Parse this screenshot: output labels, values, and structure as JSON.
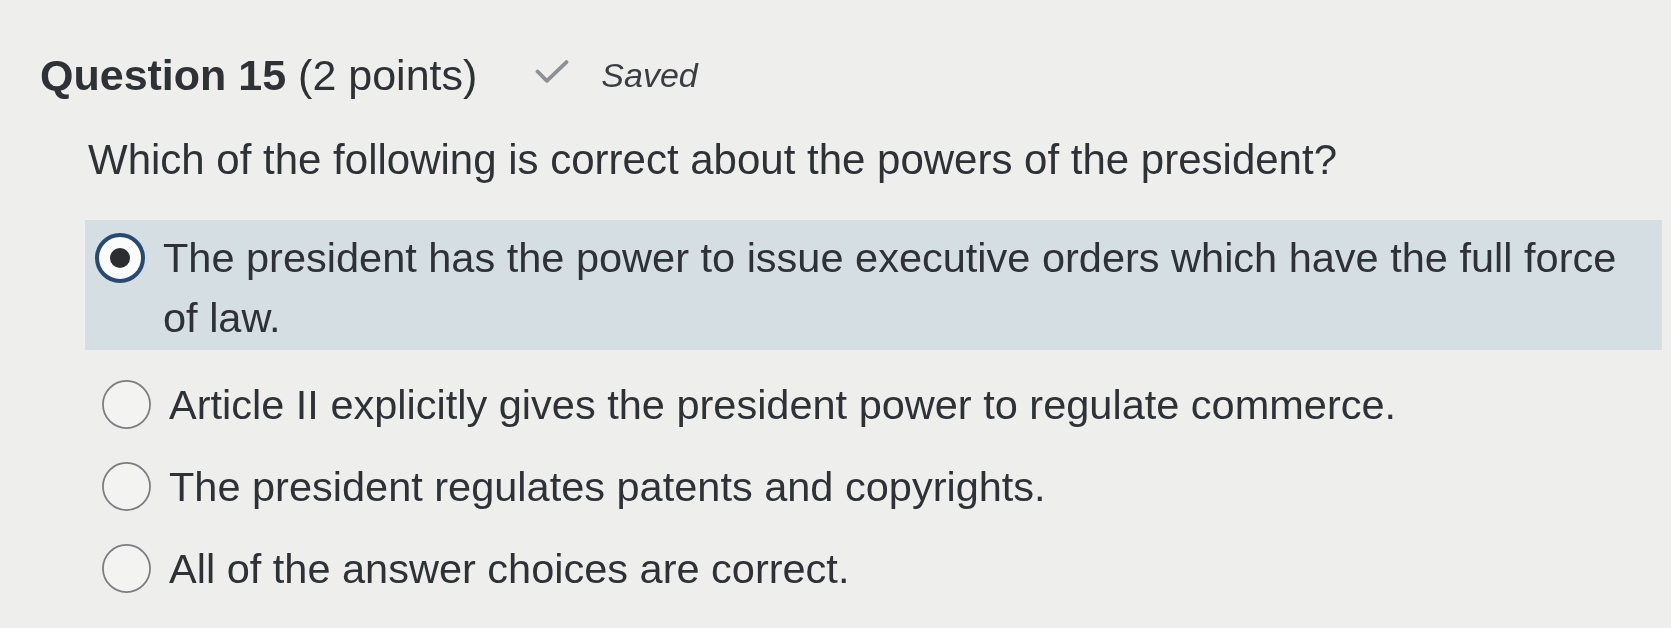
{
  "question": {
    "heading": "**Question 15** (2 points)",
    "status": "Saved",
    "prompt": "Which of the following is correct about the powers of the president?"
  },
  "options": [
    {
      "label": "The president has the power to issue executive orders which have the full force of law.",
      "selected": true
    },
    {
      "label": "Article II explicitly gives the president power to regulate commerce.",
      "selected": false
    },
    {
      "label": "The president regulates patents and copyrights.",
      "selected": false
    },
    {
      "label": "All of the answer choices are correct.",
      "selected": false
    }
  ]
}
